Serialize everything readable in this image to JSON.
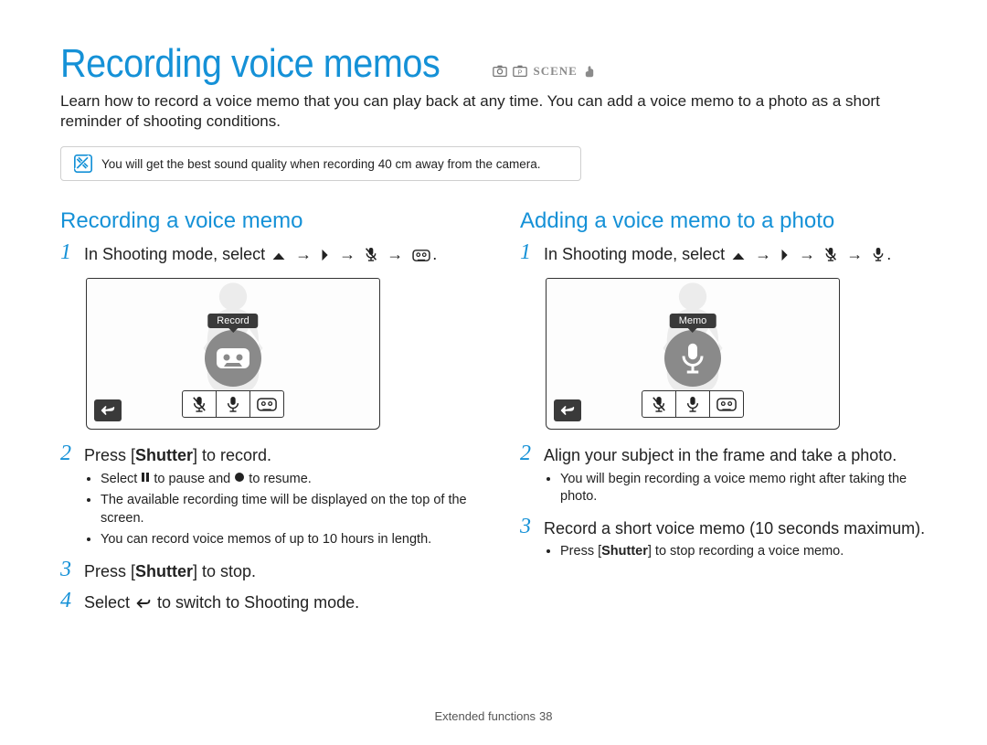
{
  "title": "Recording voice memos",
  "intro": "Learn how to record a voice memo that you can play back at any time. You can add a voice memo to a photo as a short reminder of shooting conditions.",
  "note": "You will get the best sound quality when recording 40 cm away from the camera.",
  "left": {
    "heading": "Recording a voice memo",
    "step1_prefix": "In Shooting mode, select ",
    "screenshot_label": "Record",
    "step2_pre": "Press [",
    "step2_bold": "Shutter",
    "step2_post": "] to record.",
    "bullets_2_a_pre": "Select ",
    "bullets_2_a_mid": " to pause and ",
    "bullets_2_a_post": " to resume.",
    "bullets_2_b": "The available recording time will be displayed on the top of the screen.",
    "bullets_2_c": "You can record voice memos of up to 10 hours in length.",
    "step3_pre": "Press [",
    "step3_bold": "Shutter",
    "step3_post": "] to stop.",
    "step4_pre": "Select ",
    "step4_post": " to switch to Shooting mode."
  },
  "right": {
    "heading": "Adding a voice memo to a photo",
    "step1_prefix": "In Shooting mode, select ",
    "screenshot_label": "Memo",
    "step2": "Align your subject in the frame and take a photo.",
    "bullets_2_a": "You will begin recording a voice memo right after taking the photo.",
    "step3": "Record a short voice memo (10 seconds maximum).",
    "bullets_3_a_pre": "Press [",
    "bullets_3_a_bold": "Shutter",
    "bullets_3_a_post": "] to stop recording a voice memo."
  },
  "footer_label": "Extended functions",
  "footer_page": "38",
  "mode_scene_text": "SCENE"
}
